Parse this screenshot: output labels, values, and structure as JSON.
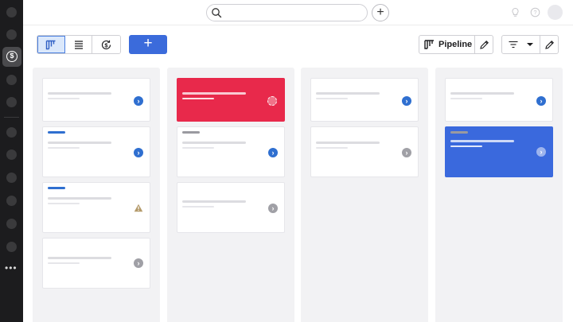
{
  "topbar": {
    "search_placeholder": ""
  },
  "toolbar": {
    "views": [
      {
        "icon": "pipeline-view-icon",
        "active": true
      },
      {
        "icon": "list-view-icon",
        "active": false
      },
      {
        "icon": "forecast-view-icon",
        "active": false
      }
    ],
    "add_label": "+",
    "pipeline_label": "Pipeline"
  },
  "colors": {
    "accent": "#3b6bdb",
    "rotting": "#e8294b",
    "selected": "#3a69dd"
  },
  "columns": [
    {
      "cards": [
        {
          "style": "normal",
          "tag": null,
          "status": "arrow-primary"
        },
        {
          "style": "normal",
          "tag": "#2f6fd0",
          "status": "arrow-primary"
        },
        {
          "style": "normal",
          "tag": "#2f6fd0",
          "status": "warning"
        },
        {
          "style": "normal",
          "tag": null,
          "status": "arrow-muted"
        }
      ]
    },
    {
      "cards": [
        {
          "style": "red",
          "tag": null,
          "status": "rotting"
        },
        {
          "style": "normal",
          "tag": "#9a9aa0",
          "status": "arrow-primary"
        },
        {
          "style": "normal",
          "tag": null,
          "status": "arrow-muted"
        }
      ]
    },
    {
      "cards": [
        {
          "style": "normal",
          "tag": null,
          "status": "arrow-primary"
        },
        {
          "style": "normal",
          "tag": null,
          "status": "arrow-muted"
        }
      ]
    },
    {
      "cards": [
        {
          "style": "normal",
          "tag": null,
          "status": "arrow-primary"
        },
        {
          "style": "blue",
          "tag": "#9a9aa0",
          "status": "arrow-ghost"
        }
      ]
    }
  ]
}
